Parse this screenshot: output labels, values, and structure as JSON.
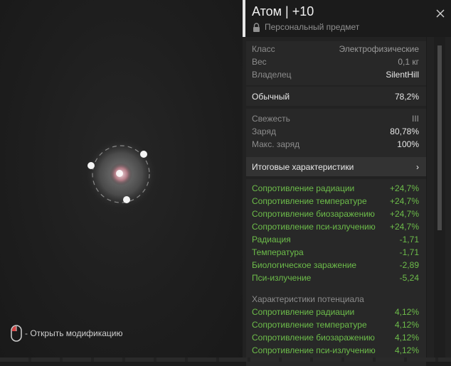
{
  "item": {
    "title": "Атом | +10",
    "subtitle": "Персональный предмет"
  },
  "info": [
    {
      "label": "Класс",
      "value": "Электрофизические"
    },
    {
      "label": "Вес",
      "value": "0,1 кг"
    },
    {
      "label": "Владелец",
      "value": "SilentHill"
    }
  ],
  "quality": {
    "label": "Обычный",
    "value": "78,2%"
  },
  "state": [
    {
      "label": "Свежесть",
      "value": "III"
    },
    {
      "label": "Заряд",
      "value": "80,78%"
    },
    {
      "label": "Макс. заряд",
      "value": "100%"
    }
  ],
  "totals_button": {
    "label": "Итоговые характеристики",
    "chevron": "›"
  },
  "stats": [
    {
      "label": "Сопротивление радиации",
      "value": "+24,7%",
      "positive": true
    },
    {
      "label": "Сопротивление температуре",
      "value": "+24,7%",
      "positive": true
    },
    {
      "label": "Сопротивление биозаражению",
      "value": "+24,7%",
      "positive": true
    },
    {
      "label": "Сопротивление пси-излучению",
      "value": "+24,7%",
      "positive": true
    },
    {
      "label": "Радиация",
      "value": "-1,71",
      "positive": true
    },
    {
      "label": "Температура",
      "value": "-1,71",
      "positive": true
    },
    {
      "label": "Биологическое заражение",
      "value": "-2,89",
      "positive": true
    },
    {
      "label": "Пси-излучение",
      "value": "-5,24",
      "positive": true
    }
  ],
  "potential": {
    "heading": "Характеристики потенциала",
    "rows": [
      {
        "label": "Сопротивление радиации",
        "value": "4,12%"
      },
      {
        "label": "Сопротивление температуре",
        "value": "4,12%"
      },
      {
        "label": "Сопротивление биозаражению",
        "value": "4,12%"
      },
      {
        "label": "Сопротивление пси-излучению",
        "value": "4,12%"
      }
    ]
  },
  "hint": {
    "text": "- Открыть модификацию",
    "icon": "mouse-left-click-icon"
  },
  "colors": {
    "positive": "#6dbd4a",
    "panel": "#222222",
    "accent": "#e6e6e6"
  }
}
